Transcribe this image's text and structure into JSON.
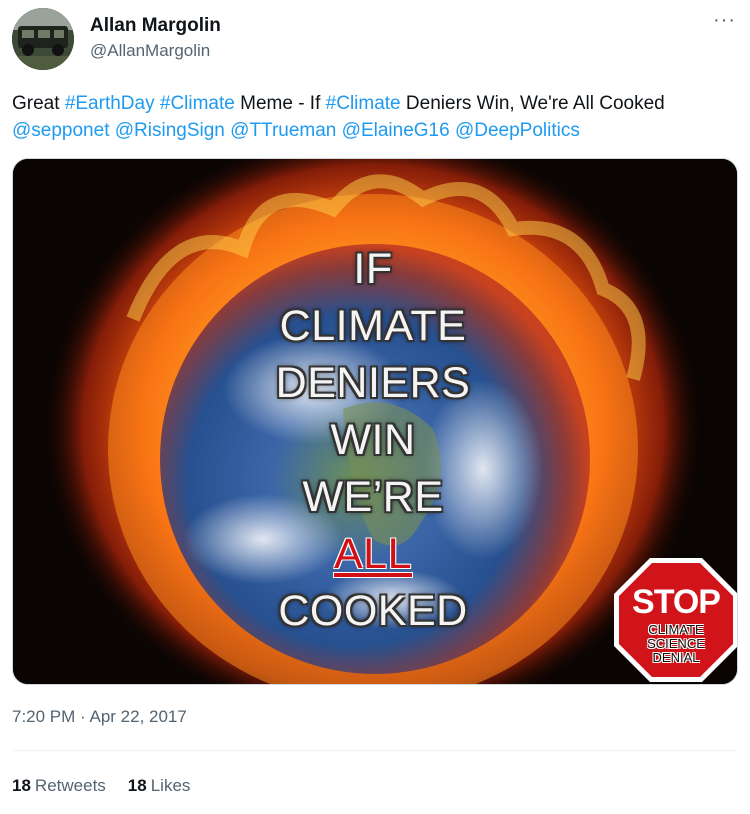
{
  "author": {
    "name": "Allan Margolin",
    "handle": "@AllanMargolin"
  },
  "more_icon": "more-horizontal-icon",
  "tweet": {
    "p1": "Great ",
    "h1": "#EarthDay",
    "p2": " ",
    "h2": "#Climate",
    "p3": " Meme - If ",
    "h3": "#Climate",
    "p4": " Deniers Win, We're All Cooked ",
    "m1": "@sepponet",
    "m2": "@RisingSign",
    "m3": "@TTrueman",
    "m4": "@ElaineG16",
    "m5": "@DeepPolitics"
  },
  "image": {
    "lines": [
      "IF",
      "CLIMATE",
      "DENIERS",
      "WIN",
      "WE’RE",
      "ALL",
      "COOKED"
    ],
    "stop": {
      "title": "STOP",
      "sub1": "CLIMATE",
      "sub2": "SCIENCE",
      "sub3": "DENIAL"
    }
  },
  "timestamp": "7:20 PM · Apr 22, 2017",
  "stats": {
    "retweets_count": "18",
    "retweets_label": "Retweets",
    "likes_count": "18",
    "likes_label": "Likes"
  },
  "colors": {
    "link": "#1d9bf0",
    "secondary_text": "#536471",
    "stop_red": "#d0141a"
  }
}
